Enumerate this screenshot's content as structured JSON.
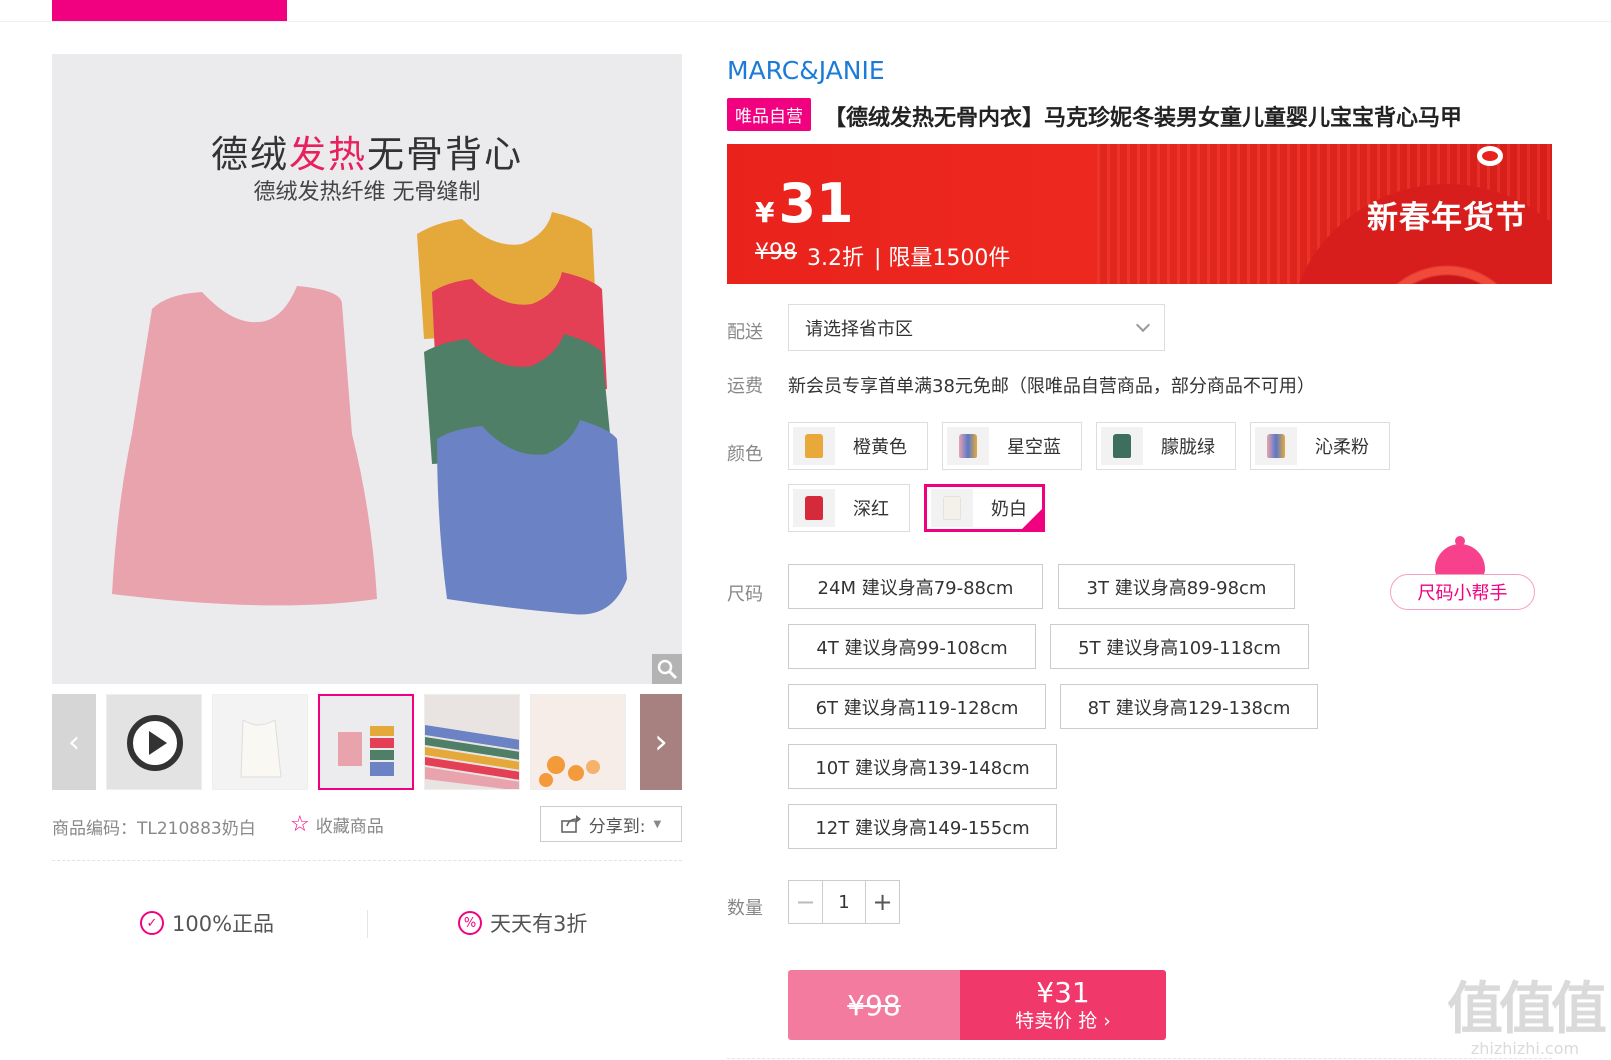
{
  "topbar": {
    "active_color": "#f10180"
  },
  "gallery": {
    "headline_pre": "德绒",
    "headline_hot": "发热",
    "headline_post": "无骨背心",
    "subheadline": "德绒发热纤维 无骨缝制",
    "zoom_icon": "magnifier-icon",
    "thumbnails": [
      {
        "name": "video-play",
        "type": "video"
      },
      {
        "name": "white-vest"
      },
      {
        "name": "vest-poster",
        "selected": true
      },
      {
        "name": "fabric-stack"
      },
      {
        "name": "fabric-detail"
      },
      {
        "name": "vest-partial"
      }
    ],
    "prev_glyph": "‹",
    "next_glyph": "›"
  },
  "meta": {
    "code_label": "商品编码：TL210883奶白",
    "favorite_label": "收藏商品",
    "share_label": "分享到:"
  },
  "guarantees": [
    {
      "icon": "shield-check-icon",
      "label": "100%正品"
    },
    {
      "icon": "percent-icon",
      "label": "天天有3折"
    }
  ],
  "product": {
    "brand": "MARC&JANIE",
    "self_tag": "唯品自营",
    "title": "【德绒发热无骨内衣】马克珍妮冬装男女童儿童婴儿宝宝背心马甲"
  },
  "price": {
    "currency": "¥",
    "current": "31",
    "original": "¥98",
    "discount": "3.2折",
    "limit": "| 限量1500件",
    "festival": "新春年货节"
  },
  "delivery": {
    "label": "配送",
    "placeholder": "请选择省市区"
  },
  "shipping": {
    "label": "运费",
    "text": "新会员专享首单满38元免邮（限唯品自营商品，部分商品不可用）"
  },
  "colors": {
    "label": "颜色",
    "options": [
      {
        "label": "橙黄色",
        "swatch": "#e8a93a"
      },
      {
        "label": "星空蓝",
        "swatch": "#5b78c9"
      },
      {
        "label": "朦胧绿",
        "swatch": "#3d6e5e"
      },
      {
        "label": "沁柔粉",
        "swatch": "#e9a7b4"
      },
      {
        "label": "深红",
        "swatch": "#d42a3a"
      },
      {
        "label": "奶白",
        "swatch": "#f4f1ea",
        "selected": true
      }
    ]
  },
  "sizes": {
    "label": "尺码",
    "helper": "尺码小帮手",
    "options": [
      "24M 建议身高79-88cm",
      "3T 建议身高89-98cm",
      "4T 建议身高99-108cm",
      "5T 建议身高109-118cm",
      "6T 建议身高119-128cm",
      "8T 建议身高129-138cm",
      "10T 建议身高139-148cm",
      "12T 建议身高149-155cm"
    ]
  },
  "quantity": {
    "label": "数量",
    "value": "1",
    "minus": "−",
    "plus": "+"
  },
  "buy": {
    "original": "¥98",
    "price": "¥31",
    "action": "特卖价 抢 ›"
  },
  "watermark": {
    "big": "值值值",
    "small": "zhizhizhi.com"
  }
}
